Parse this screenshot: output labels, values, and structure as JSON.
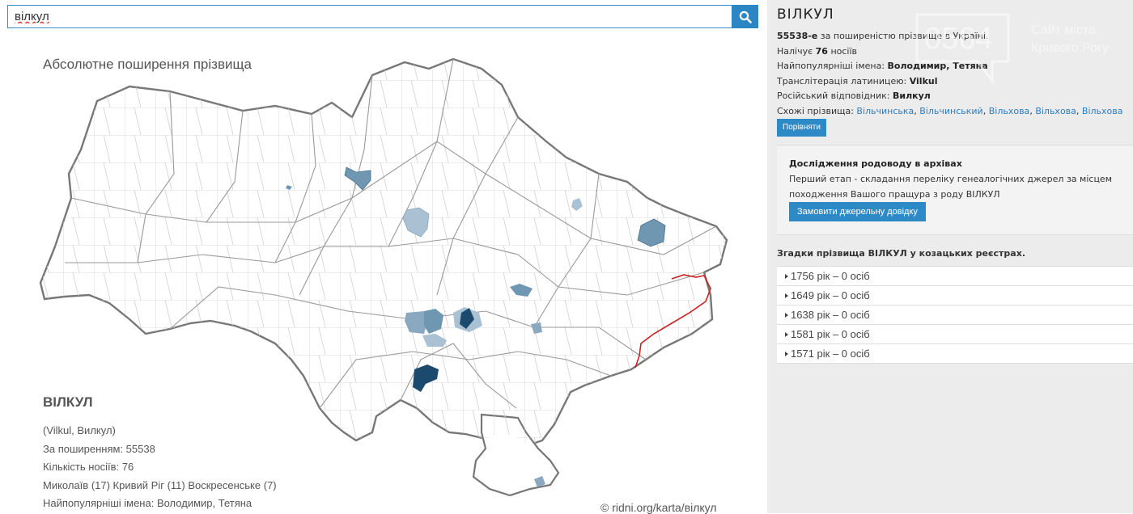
{
  "search": {
    "value": "вілкул"
  },
  "map": {
    "title": "Абсолютне поширення прізвища",
    "info_name": "ВІЛКУЛ",
    "info_lines": [
      "(Vilkul, Вилкул)",
      "За поширенням: 55538",
      "Кількість носіїв:  76",
      "Миколаїв (17) Кривий Ріг (11) Воскресенське (7)",
      "Найпопулярніші імена: Володимир, Тетяна"
    ],
    "copyright": "© ridni.org/karta/вілкул",
    "colors": {
      "light": "#a9c1d3",
      "mid": "#6f97b2",
      "dark": "#2f5f86",
      "darkest": "#1c4a6e",
      "border": "#cc2222"
    }
  },
  "details": {
    "title": "ВІЛКУЛ",
    "rank_value": "55538-е",
    "rank_suffix": " за поширеністю прізвище в Україні.",
    "carriers_prefix": "Налічує ",
    "carriers_value": "76",
    "carriers_suffix": " носіїв",
    "names_label": "Найпопулярніші імена: ",
    "names_value": "Володимир, Тетяна",
    "translit_label": "Транслітерація латиницею: ",
    "translit_value": "Vilkul",
    "russian_label": "Російський відповідник: ",
    "russian_value": "Вилкул",
    "similar_label": "Схожі прізвища: ",
    "similar": [
      "Вільчинська",
      "Вільчинський",
      "Вільхова",
      "Вільхова",
      "Вільхова"
    ],
    "compare_button": "Порівняти"
  },
  "archive": {
    "title": "Дослідження родоводу в архівах",
    "text": "Перший етап - складання переліку генеалогічних джерел за місцем походження Вашого пращура з роду ВІЛКУЛ",
    "button": "Замовити джерельну довідку"
  },
  "kozak": {
    "title": "Згадки прізвища ВІЛКУЛ у козацьких реєстрах.",
    "items": [
      "1756 рік – 0 осіб",
      "1649 рік – 0 осіб",
      "1638 рік – 0 осіб",
      "1581 рік – 0 осіб",
      "1571 рік – 0 осіб"
    ]
  },
  "watermark": {
    "number": "0564",
    "line1": "Сайт міста",
    "line2": "Кривого Рогу"
  }
}
